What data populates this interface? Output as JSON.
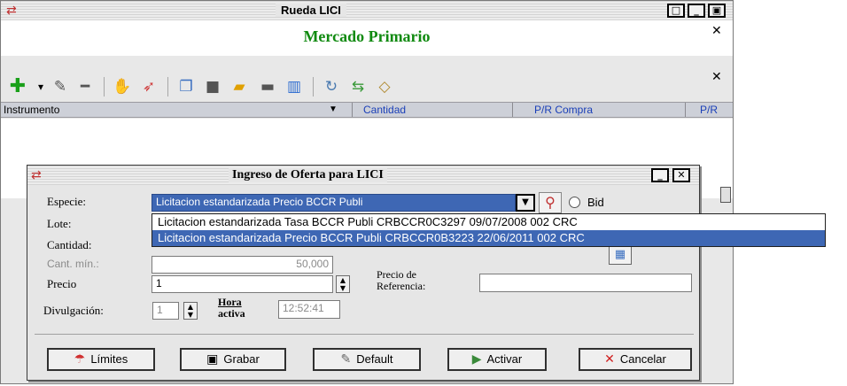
{
  "main_window": {
    "title": "Rueda LICI",
    "header": "Mercado Primario",
    "grid_columns": [
      "Instrumento",
      "Cantidad",
      "P/R Compra",
      "P/R"
    ]
  },
  "toolbar": {
    "buttons": [
      "add-icon",
      "dropdown-arrow-icon",
      "pencil-icon",
      "remove-icon",
      "handshake-icon",
      "rocket-icon",
      "windows-icon",
      "folder-icon",
      "bar-icon",
      "screen-icon",
      "chart-icon",
      "refresh-icon",
      "transfer-icon",
      "tag-icon"
    ]
  },
  "dialog": {
    "title": "Ingreso de Oferta para LICI",
    "fields": {
      "especie_label": "Especie:",
      "especie_value": "Licitacion estandarizada Precio BCCR Publi",
      "bid_label": "Bid",
      "lote_label": "Lote:",
      "cantidad_label": "Cantidad:",
      "cant_min_label": "Cant. mín.:",
      "cant_min_value": "50,000",
      "precio_label": "Precio",
      "precio_value": "1",
      "precio_ref_label_1": "Precio de",
      "precio_ref_label_2": "Referencia:",
      "precio_ref_value": "",
      "divulgacion_label": "Divulgación:",
      "divulgacion_value": "1",
      "hora_label_1": "Hora",
      "hora_label_2": "activa",
      "hora_value": "12:52:41"
    },
    "buttons": {
      "limites": "Límites",
      "grabar": "Grabar",
      "default": "Default",
      "activar": "Activar",
      "cancelar": "Cancelar"
    }
  },
  "dropdown": {
    "options": [
      "Licitacion estandarizada Tasa BCCR Publi CRBCCR0C3297 09/07/2008 002 CRC",
      "Licitacion estandarizada Precio BCCR Publi CRBCCR0B3223 22/06/2011 002 CRC"
    ],
    "selected_index": 1
  },
  "colors": {
    "header_green": "#108a10",
    "selection_blue": "#3e67b4",
    "grid_link_blue": "#1a3fb8"
  }
}
